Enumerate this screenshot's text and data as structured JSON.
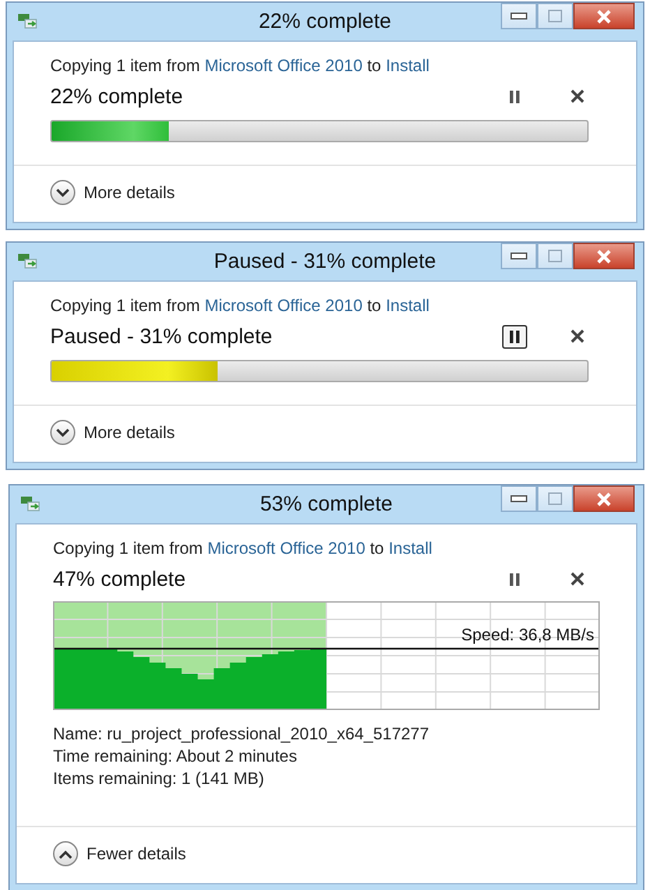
{
  "windows": [
    {
      "title": "22% complete",
      "copy_line": {
        "prefix": "Copying 1 item from",
        "source": "Microsoft Office 2010",
        "joiner": "to",
        "destination": "Install"
      },
      "status": "22% complete",
      "paused": false,
      "kind": "bar",
      "level": 0.22,
      "details_expanded": false,
      "toggle_label": "More details"
    },
    {
      "title": "Paused - 31% complete",
      "copy_line": {
        "prefix": "Copying 1 item from",
        "source": "Microsoft Office 2010",
        "joiner": "to",
        "destination": "Install"
      },
      "status": "Paused - 31% complete",
      "paused": true,
      "kind": "bar",
      "level": 0.31,
      "details_expanded": false,
      "toggle_label": "More details"
    },
    {
      "title": "53% complete",
      "copy_line": {
        "prefix": "Copying 1 item from",
        "source": "Microsoft Office 2010",
        "joiner": "to",
        "destination": "Install"
      },
      "status": "47% complete",
      "paused": false,
      "kind": "graph",
      "level": 0.5,
      "speed": "Speed: 36,8 MB/s",
      "details": [
        {
          "label": "Name:",
          "value": "ru_project_professional_2010_x64_517277"
        },
        {
          "label": "Time remaining:",
          "value": "About 2 minutes"
        },
        {
          "label": "Items remaining:",
          "value": "1 (141 MB)"
        }
      ],
      "details_expanded": true,
      "toggle_label": "Fewer details"
    }
  ]
}
